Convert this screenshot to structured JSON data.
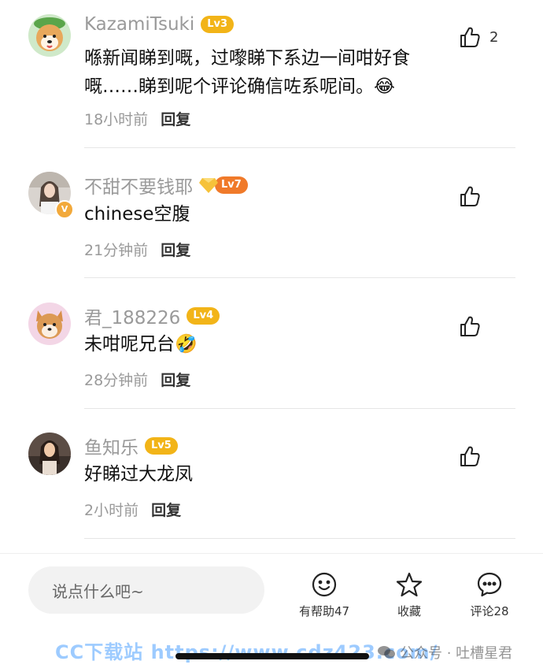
{
  "comments": [
    {
      "username": "KazamiTsuki",
      "level": "Lv3",
      "content": "喺新闻睇到嘅，过嚟睇下系边一间咁好食嘅……睇到呢个评论确信咗系呢间。😂",
      "time": "18小时前",
      "reply_label": "回复",
      "likes": "2",
      "avatar_icon": "shiba-dog-avatar"
    },
    {
      "username": "不甜不要钱耶",
      "level": "Lv7",
      "content": "chinese空腹",
      "time": "21分钟前",
      "reply_label": "回复",
      "likes": "",
      "avatar_icon": "girl-photo-avatar"
    },
    {
      "username": "君_188226",
      "level": "Lv4",
      "content": "未咁呢兄台🤣",
      "time": "28分钟前",
      "reply_label": "回复",
      "likes": "",
      "avatar_icon": "shiba-avatar"
    },
    {
      "username": "鱼知乐",
      "level": "Lv5",
      "content": "好睇过大龙凤",
      "time": "2小时前",
      "reply_label": "回复",
      "likes": "",
      "avatar_icon": "woman-photo-avatar"
    }
  ],
  "bottom_bar": {
    "input_placeholder": "说点什么吧~",
    "helpful_label": "有帮助47",
    "favorite_label": "收藏",
    "comments_label": "评论28"
  },
  "watermark": {
    "left_text": "CC下载站  https://www.cdz423.com/",
    "right_text": "公众号 · 吐槽星君"
  },
  "colors": {
    "level_badge": "#f2b418",
    "level_badge_vip": "#f07a2a",
    "username": "#9a9a9a"
  }
}
